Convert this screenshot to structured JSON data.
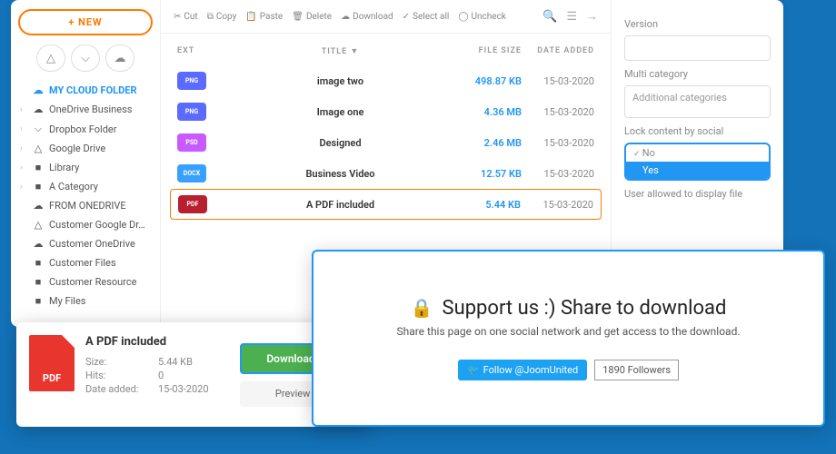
{
  "new_button": "+ NEW",
  "toolbar": {
    "cut": "Cut",
    "copy": "Copy",
    "paste": "Paste",
    "delete": "Delete",
    "download": "Download",
    "select_all": "Select all",
    "uncheck": "Uncheck"
  },
  "tree": [
    {
      "label": "MY CLOUD FOLDER",
      "active": true,
      "icon": "cloud"
    },
    {
      "label": "OneDrive Business",
      "chev": true,
      "icon": "cloud"
    },
    {
      "label": "Dropbox Folder",
      "chev": true,
      "icon": "dropbox"
    },
    {
      "label": "Google Drive",
      "chev": true,
      "icon": "gdrive"
    },
    {
      "label": "Library",
      "chev": true,
      "icon": "folder"
    },
    {
      "label": "A Category",
      "chev": true,
      "icon": "folder"
    },
    {
      "label": "FROM ONEDRIVE",
      "icon": "cloud"
    },
    {
      "label": "Customer Google Dr…",
      "icon": "gdrive"
    },
    {
      "label": "Customer OneDrive",
      "icon": "cloud"
    },
    {
      "label": "Customer Files",
      "icon": "folder"
    },
    {
      "label": "Customer Resource",
      "icon": "folder"
    },
    {
      "label": "My Files",
      "icon": "folder"
    }
  ],
  "columns": {
    "ext": "EXT",
    "title": "TITLE ▼",
    "size": "FILE SIZE",
    "date": "DATE ADDED"
  },
  "files": [
    {
      "ext": "PNG",
      "cls": "b-png",
      "title": "image two",
      "size": "498.87 KB",
      "date": "15-03-2020"
    },
    {
      "ext": "PNG",
      "cls": "b-png",
      "title": "Image one",
      "size": "4.36 MB",
      "date": "15-03-2020"
    },
    {
      "ext": "PSD",
      "cls": "b-psd",
      "title": "Designed",
      "size": "2.46 MB",
      "date": "15-03-2020"
    },
    {
      "ext": "DOCX",
      "cls": "b-docx",
      "title": "Business Video",
      "size": "12.57 KB",
      "date": "15-03-2020"
    },
    {
      "ext": "PDF",
      "cls": "b-pdf",
      "title": "A PDF included",
      "size": "5.44 KB",
      "date": "15-03-2020",
      "sel": true
    }
  ],
  "rpanel": {
    "version_lbl": "Version",
    "multi_lbl": "Multi category",
    "multi_placeholder": "Additional categories",
    "lock_lbl": "Lock content by social",
    "opt_no": "No",
    "opt_yes": "Yes",
    "user_lbl": "User allowed to display file"
  },
  "detail": {
    "thumb": "PDF",
    "title": "A PDF included",
    "size_lbl": "Size:",
    "size": "5.44 KB",
    "hits_lbl": "Hits:",
    "hits": "0",
    "date_lbl": "Date added:",
    "date": "15-03-2020",
    "download": "Download",
    "preview": "Preview"
  },
  "share": {
    "heading": "Support us :) Share to download",
    "sub": "Share this page on one social network and get access to the download.",
    "follow": "Follow @JoomUnited",
    "followers": "1890 Followers"
  }
}
